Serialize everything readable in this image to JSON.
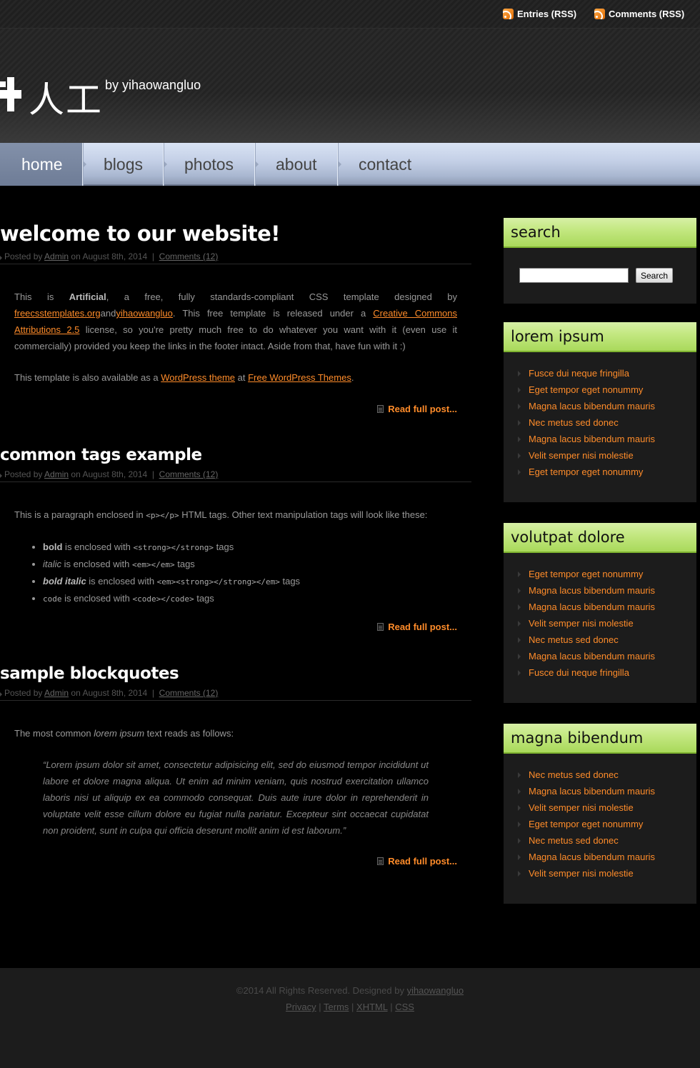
{
  "topbar": {
    "entries_rss": "Entries (RSS)",
    "comments_rss": "Comments (RSS)"
  },
  "header": {
    "logo_text": "人工",
    "tagline": "by yihaowangluo"
  },
  "nav": {
    "items": [
      {
        "label": "home",
        "active": true
      },
      {
        "label": "blogs",
        "active": false
      },
      {
        "label": "photos",
        "active": false
      },
      {
        "label": "about",
        "active": false
      },
      {
        "label": "contact",
        "active": false
      }
    ]
  },
  "meta": {
    "posted_by": "Posted by",
    "author": "Admin",
    "on": "on",
    "date": "August 8th, 2014",
    "sep": "|",
    "comments": "Comments (12)"
  },
  "posts": [
    {
      "title": "welcome to our website!",
      "p1": {
        "a": "This is ",
        "bold": "Artificial",
        "b": ", a free, fully standards-compliant CSS template designed by ",
        "link1": "freecsstemplates.org",
        "and": "and",
        "link2": "yihaowangluo",
        "c": ". This free template is released under a ",
        "link3": "Creative Commons Attributions 2.5",
        "d": " license, so you're pretty much free to do whatever you want with it (even use it commercially) provided you keep the links in the footer intact. Aside from that, have fun with it :)"
      },
      "p2": {
        "a": "This template is also available as a ",
        "link1": "WordPress theme",
        "b": " at ",
        "link2": "Free WordPress Themes",
        "c": "."
      },
      "read_more": "Read full post..."
    },
    {
      "title": "common tags example",
      "intro": {
        "a": "This is a paragraph enclosed in ",
        "code": "<p></p>",
        "b": " HTML tags. Other text manipulation tags will look like these:"
      },
      "items": [
        {
          "styled": "bold",
          "mid": " is enclosed with ",
          "code": "<strong></strong>",
          "end": " tags"
        },
        {
          "styled": "italic",
          "mid": " is enclosed with ",
          "code": "<em></em>",
          "end": " tags"
        },
        {
          "styled": "bold italic",
          "mid": " is enclosed with ",
          "code": "<em><strong></strong></em>",
          "end": " tags"
        },
        {
          "styled": "code",
          "mid": " is enclosed with ",
          "code": "<code></code>",
          "end": " tags"
        }
      ],
      "read_more": "Read full post..."
    },
    {
      "title": "sample blockquotes",
      "intro": {
        "a": "The most common ",
        "em": "lorem ipsum",
        "b": " text reads as follows:"
      },
      "quote": "“Lorem ipsum dolor sit amet, consectetur adipisicing elit, sed do eiusmod tempor incididunt ut labore et dolore magna aliqua. Ut enim ad minim veniam, quis nostrud exercitation ullamco laboris nisi ut aliquip ex ea commodo consequat. Duis aute irure dolor in reprehenderit in voluptate velit esse cillum dolore eu fugiat nulla pariatur. Excepteur sint occaecat cupidatat non proident, sunt in culpa qui officia deserunt mollit anim id est laborum.”",
      "read_more": "Read full post..."
    }
  ],
  "sidebar": {
    "search": {
      "title": "search",
      "placeholder": "",
      "button": "Search"
    },
    "widgets": [
      {
        "title": "lorem ipsum",
        "links": [
          "Fusce dui neque fringilla",
          "Eget tempor eget nonummy",
          "Magna lacus bibendum mauris",
          "Nec metus sed donec",
          "Magna lacus bibendum mauris",
          "Velit semper nisi molestie",
          "Eget tempor eget nonummy"
        ]
      },
      {
        "title": "volutpat dolore",
        "links": [
          "Eget tempor eget nonummy",
          "Magna lacus bibendum mauris",
          "Magna lacus bibendum mauris",
          "Velit semper nisi molestie",
          "Nec metus sed donec",
          "Magna lacus bibendum mauris",
          "Fusce dui neque fringilla"
        ]
      },
      {
        "title": "magna bibendum",
        "links": [
          "Nec metus sed donec",
          "Magna lacus bibendum mauris",
          "Velit semper nisi molestie",
          "Eget tempor eget nonummy",
          "Nec metus sed donec",
          "Magna lacus bibendum mauris",
          "Velit semper nisi molestie"
        ]
      }
    ]
  },
  "footer": {
    "copyright": "©2014 All Rights Reserved. Designed by ",
    "designer": "yihaowangluo",
    "links": [
      "Privacy",
      "Terms",
      "XHTML",
      "CSS"
    ],
    "sep": " | "
  },
  "colors": {
    "accent": "#ff8c2a",
    "nav_bg": "#c3cfe6",
    "widget_head": "#c4e882"
  }
}
